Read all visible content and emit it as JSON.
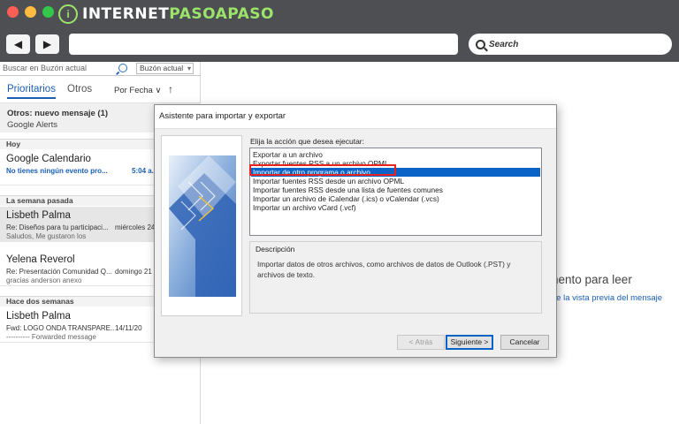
{
  "browser": {
    "brand_prefix": "INTERNET",
    "brand_accent": "PASOAPASO",
    "brand_initial": "i",
    "search_label": "Search",
    "colors": {
      "chrome": "#4d4f52",
      "brand_accent": "#9be36a",
      "close": "#fc5d55",
      "minimize": "#fdbc3f",
      "maximize": "#34c84a"
    }
  },
  "outlook": {
    "search": {
      "placeholder": "Buscar en Buzón actual",
      "scope": "Buzón actual"
    },
    "tabs": {
      "priority": "Prioritarios",
      "others": "Otros"
    },
    "sort_label": "Por Fecha ∨",
    "sort_arrow": "↑",
    "otros_notice": {
      "title": "Otros: nuevo mensaje (1)",
      "sender": "Google Alerts"
    },
    "groups": {
      "today": "Hoy",
      "last_week": "La semana pasada",
      "two_weeks": "Hace dos semanas"
    },
    "messages": [
      {
        "from": "Google Calendario",
        "subject": "No tienes ningún evento pro...",
        "date": "5:04 a.",
        "preview": ""
      },
      {
        "from": "Lisbeth Palma",
        "subject": "Re: Diseños para tu participaci...",
        "date": "miércoles 24",
        "preview": "Saludos,   Me gustaron los"
      },
      {
        "from": "Yelena Reverol",
        "subject": "Re: Presentación Comunidad Q...",
        "date": "domingo 21",
        "preview": "gracias anderson anexo"
      },
      {
        "from": "Lisbeth Palma",
        "subject": "Fwd: LOGO ONDA TRANSPARE...",
        "date": "14/11/20",
        "preview": "---------- Forwarded message"
      }
    ],
    "reading_pane": {
      "title": "nento para leer",
      "link": "re la vista previa del mensaje"
    },
    "colors": {
      "accent": "#1a5fb4"
    }
  },
  "dialog": {
    "title": "Asistente para importar y exportar",
    "prompt": "Elija la acción que desea ejecutar:",
    "options": [
      "Exportar a un archivo",
      "Exportar fuentes RSS a un archivo OPML",
      "Importar de otro programa o archivo",
      "Importar fuentes RSS desde un archivo OPML",
      "Importar fuentes RSS desde una lista de fuentes comunes",
      "Importar un archivo de iCalendar (.ics) o vCalendar (.vcs)",
      "Importar un archivo vCard (.vcf)"
    ],
    "selected_option": "Importar de otro programa o archivo",
    "description_label": "Descripción",
    "description_text": "Importar datos de otros archivos, como archivos de datos de Outlook (.PST) y archivos de texto.",
    "buttons": {
      "back": "< Atrás",
      "next": "Siguiente >",
      "cancel": "Cancelar"
    },
    "colors": {
      "selection": "#0a64c8",
      "highlight_box": "#e8231b"
    }
  }
}
